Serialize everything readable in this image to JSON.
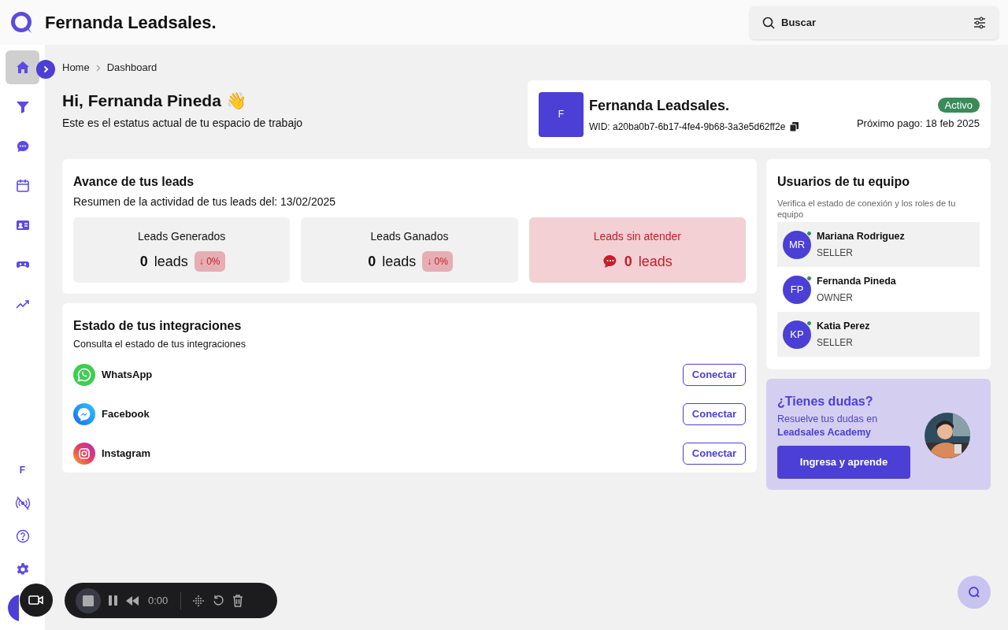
{
  "header": {
    "brand": "Fernanda Leadsales.",
    "search": {
      "placeholder": "Buscar"
    }
  },
  "sidebar": {
    "items": [
      {
        "kind": "home",
        "selected": true
      },
      {
        "kind": "filter",
        "selected": false
      },
      {
        "kind": "chat",
        "selected": false
      },
      {
        "kind": "calendar",
        "selected": false
      },
      {
        "kind": "contacts",
        "selected": false
      },
      {
        "kind": "bot",
        "selected": false
      },
      {
        "kind": "trend",
        "selected": false
      }
    ],
    "workspace_initial": "F"
  },
  "breadcrumb": [
    "Home",
    "Dashboard"
  ],
  "greeting": {
    "title": "Hi, Fernanda Pineda 👋",
    "subtitle": "Este es el estatus actual de tu espacio de trabajo"
  },
  "workspace": {
    "initial": "F",
    "name": "Fernanda Leadsales.",
    "wid": "WID: a20ba0b7-6b17-4fe4-9b68-3a3e5d62ff2e",
    "status": "Activo",
    "next_payment": "Próximo pago: 18 feb 2025"
  },
  "leads": {
    "title": "Avance de tus leads",
    "subtitle": "Resumen de la actividad de tus leads del: 13/02/2025",
    "stats": [
      {
        "kind": "normal",
        "label": "Leads Generados",
        "count": "0",
        "unit": "leads",
        "delta": "↓ 0%"
      },
      {
        "kind": "normal",
        "label": "Leads Ganados",
        "count": "0",
        "unit": "leads",
        "delta": "↓ 0%"
      },
      {
        "kind": "alert",
        "label": "Leads sin atender",
        "count": "0",
        "unit": "leads"
      }
    ]
  },
  "integrations": {
    "title": "Estado de tus integraciones",
    "subtitle": "Consulta el estado de tus integraciones",
    "items": [
      {
        "kind": "whatsapp",
        "name": "WhatsApp",
        "action": "Conectar"
      },
      {
        "kind": "messenger",
        "name": "Facebook",
        "action": "Conectar"
      },
      {
        "kind": "instagram",
        "name": "Instagram",
        "action": "Conectar"
      }
    ]
  },
  "team": {
    "title": "Usuarios de tu equipo",
    "subtitle": "Verifica el estado de conexión y los roles de tu equipo",
    "members": [
      {
        "initials": "MR",
        "name": "Mariana Rodriguez",
        "role": "SELLER",
        "online": true
      },
      {
        "initials": "FP",
        "name": "Fernanda Pineda",
        "role": "OWNER",
        "online": true
      },
      {
        "initials": "KP",
        "name": "Katia Perez",
        "role": "SELLER",
        "online": true
      }
    ]
  },
  "academy": {
    "title": "¿Tienes dudas?",
    "text": "Resuelve tus dudas en **Leadsales Academy**",
    "button": "Ingresa y aprende"
  },
  "recorder": {
    "time": "0:00"
  }
}
